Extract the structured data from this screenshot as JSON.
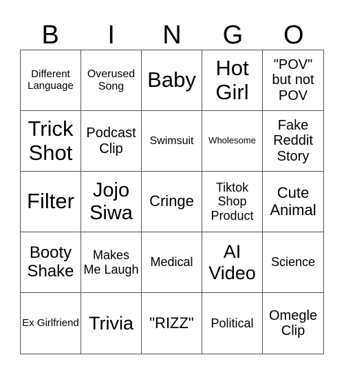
{
  "header": {
    "letters": [
      "B",
      "I",
      "N",
      "G",
      "O"
    ]
  },
  "cells": [
    {
      "text": "Different Language",
      "size": "s15"
    },
    {
      "text": "Overused Song",
      "size": "s16"
    },
    {
      "text": "Baby",
      "size": "s31"
    },
    {
      "text": "Hot Girl",
      "size": "s31"
    },
    {
      "text": "\"POV\" but not POV",
      "size": "s20"
    },
    {
      "text": "Trick Shot",
      "size": "s31"
    },
    {
      "text": "Podcast Clip",
      "size": "s20"
    },
    {
      "text": "Swimsuit",
      "size": "s16"
    },
    {
      "text": "Wholesome",
      "size": "s13"
    },
    {
      "text": "Fake Reddit Story",
      "size": "s20"
    },
    {
      "text": "Filter",
      "size": "s31"
    },
    {
      "text": "Jojo Siwa",
      "size": "s29"
    },
    {
      "text": "Cringe",
      "size": "s22"
    },
    {
      "text": "Tiktok Shop Product",
      "size": "s18"
    },
    {
      "text": "Cute Animal",
      "size": "s22"
    },
    {
      "text": "Booty Shake",
      "size": "s24"
    },
    {
      "text": "Makes Me Laugh",
      "size": "s18"
    },
    {
      "text": "Medical",
      "size": "s18"
    },
    {
      "text": "AI Video",
      "size": "s27"
    },
    {
      "text": "Science",
      "size": "s18"
    },
    {
      "text": "Ex Girlfriend",
      "size": "s15"
    },
    {
      "text": "Trivia",
      "size": "s27"
    },
    {
      "text": "\"RIZZ\"",
      "size": "s22"
    },
    {
      "text": "Political",
      "size": "s18"
    },
    {
      "text": "Omegle Clip",
      "size": "s20"
    }
  ]
}
